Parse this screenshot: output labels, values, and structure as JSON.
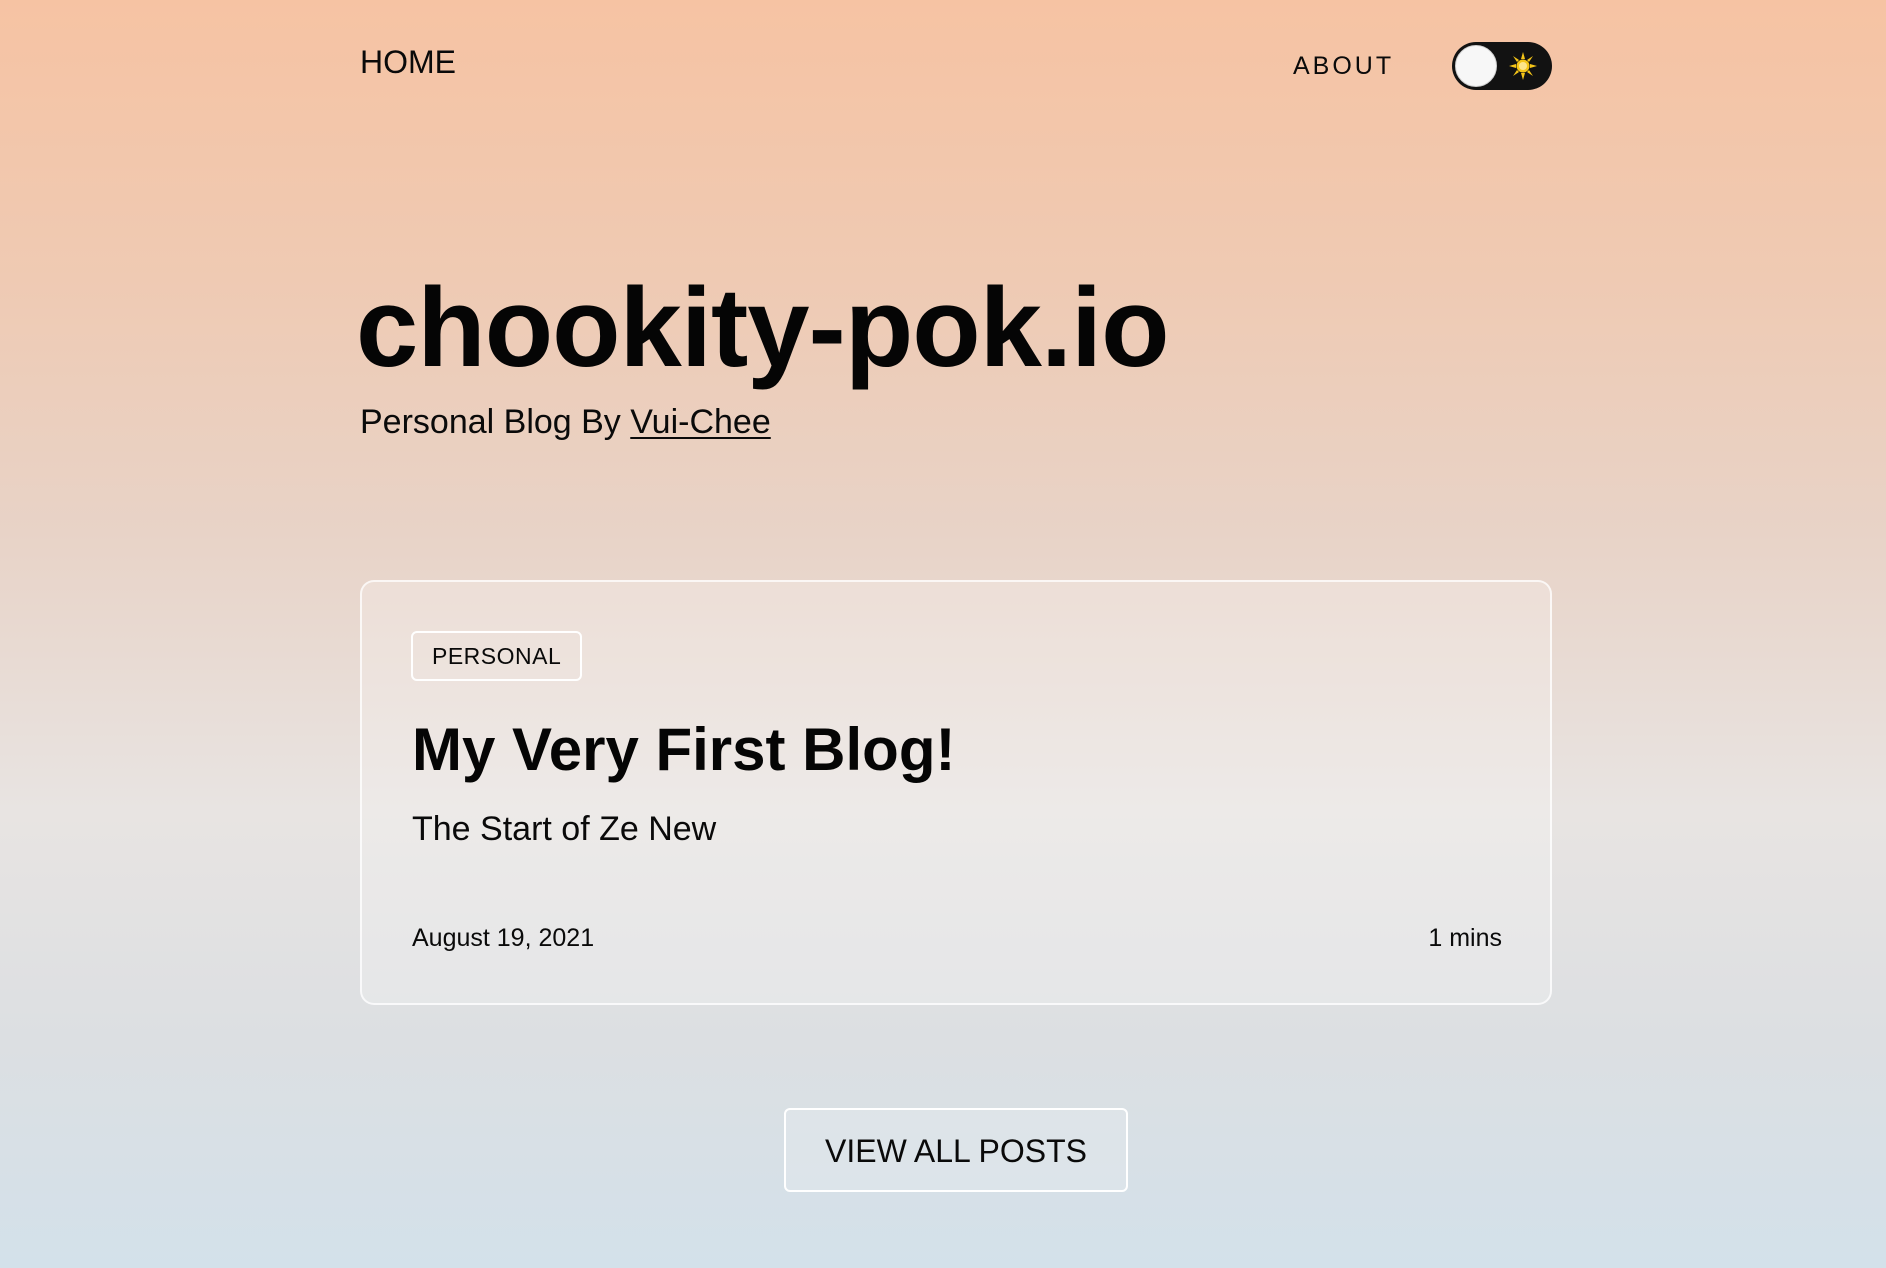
{
  "header": {
    "home_label": "HOME",
    "about_label": "ABOUT",
    "theme_toggle": {
      "state": "light",
      "icon": "sun-icon"
    }
  },
  "hero": {
    "title": "chookity-pok.io",
    "subtitle_prefix": "Personal Blog By ",
    "author_name": "Vui-Chee"
  },
  "posts": [
    {
      "tag": "PERSONAL",
      "title": "My Very First Blog!",
      "excerpt": "The Start of Ze New",
      "date": "August 19, 2021",
      "read_time": "1 mins"
    }
  ],
  "view_all_label": "VIEW ALL POSTS",
  "colors": {
    "gradient_top": "#f6c3a3",
    "gradient_bottom": "#d3e1ea",
    "toggle_background": "#121212",
    "sun": "#f5c518",
    "text": "#0a0a0a"
  }
}
